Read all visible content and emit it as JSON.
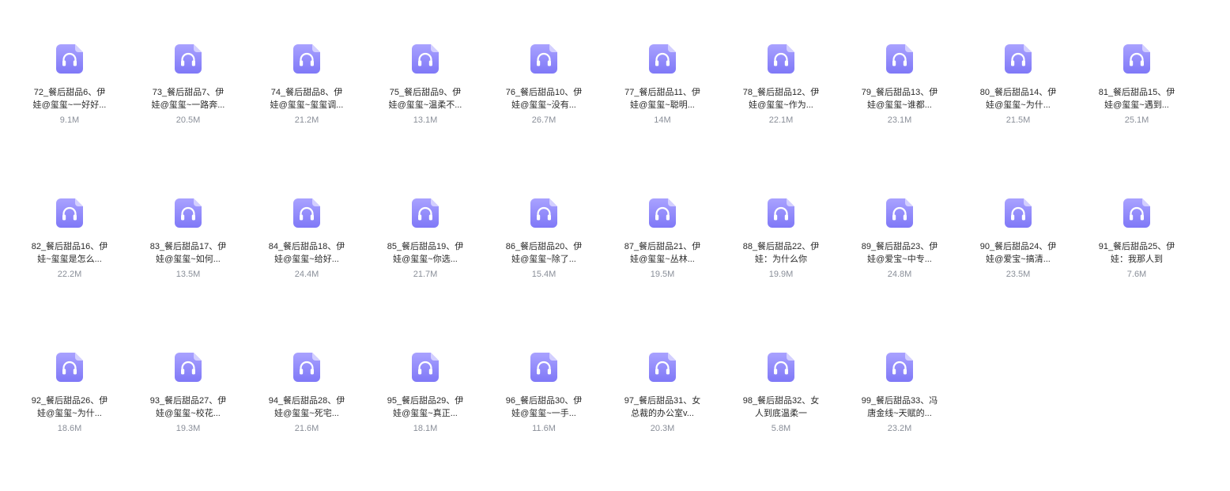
{
  "file_icon": "audio-headphones-icon",
  "colors": {
    "icon_bg_top": "#a9a2ff",
    "icon_bg_bottom": "#7f78f7",
    "icon_fold": "#d3cfff",
    "file_name": "#2a2a2a",
    "file_size": "#8a8f99"
  },
  "files": [
    {
      "name": "72_餐后甜品6、伊娃@玺玺~一好好...",
      "size": "9.1M"
    },
    {
      "name": "73_餐后甜品7、伊娃@玺玺~一路奔...",
      "size": "20.5M"
    },
    {
      "name": "74_餐后甜品8、伊娃@玺玺~玺玺调...",
      "size": "21.2M"
    },
    {
      "name": "75_餐后甜品9、伊娃@玺玺~温柔不...",
      "size": "13.1M"
    },
    {
      "name": "76_餐后甜品10、伊娃@玺玺~没有...",
      "size": "26.7M"
    },
    {
      "name": "77_餐后甜品11、伊娃@玺玺~聪明...",
      "size": "14M"
    },
    {
      "name": "78_餐后甜品12、伊娃@玺玺~作为...",
      "size": "22.1M"
    },
    {
      "name": "79_餐后甜品13、伊娃@玺玺~谁都...",
      "size": "23.1M"
    },
    {
      "name": "80_餐后甜品14、伊娃@玺玺~为什...",
      "size": "21.5M"
    },
    {
      "name": "81_餐后甜品15、伊娃@玺玺~遇到...",
      "size": "25.1M"
    },
    {
      "name": "82_餐后甜品16、伊娃~玺玺是怎么...",
      "size": "22.2M"
    },
    {
      "name": "83_餐后甜品17、伊娃@玺玺~如何...",
      "size": "13.5M"
    },
    {
      "name": "84_餐后甜品18、伊娃@玺玺~给好...",
      "size": "24.4M"
    },
    {
      "name": "85_餐后甜品19、伊娃@玺玺~你选...",
      "size": "21.7M"
    },
    {
      "name": "86_餐后甜品20、伊娃@玺玺~除了...",
      "size": "15.4M"
    },
    {
      "name": "87_餐后甜品21、伊娃@玺玺~丛林...",
      "size": "19.5M"
    },
    {
      "name": "88_餐后甜品22、伊娃：为什么你",
      "size": "19.9M"
    },
    {
      "name": "89_餐后甜品23、伊娃@爱宝~中专...",
      "size": "24.8M"
    },
    {
      "name": "90_餐后甜品24、伊娃@爱宝~搞清...",
      "size": "23.5M"
    },
    {
      "name": "91_餐后甜品25、伊娃：我那人到",
      "size": "7.6M"
    },
    {
      "name": "92_餐后甜品26、伊娃@玺玺~为什...",
      "size": "18.6M"
    },
    {
      "name": "93_餐后甜品27、伊娃@玺玺~校花...",
      "size": "19.3M"
    },
    {
      "name": "94_餐后甜品28、伊娃@玺玺~死宅...",
      "size": "21.6M"
    },
    {
      "name": "95_餐后甜品29、伊娃@玺玺~真正...",
      "size": "18.1M"
    },
    {
      "name": "96_餐后甜品30、伊娃@玺玺~一手...",
      "size": "11.6M"
    },
    {
      "name": "97_餐后甜品31、女总裁的办公室v...",
      "size": "20.3M"
    },
    {
      "name": "98_餐后甜品32、女人到底温柔一",
      "size": "5.8M"
    },
    {
      "name": "99_餐后甜品33、冯唐金线~天赋的...",
      "size": "23.2M"
    }
  ]
}
